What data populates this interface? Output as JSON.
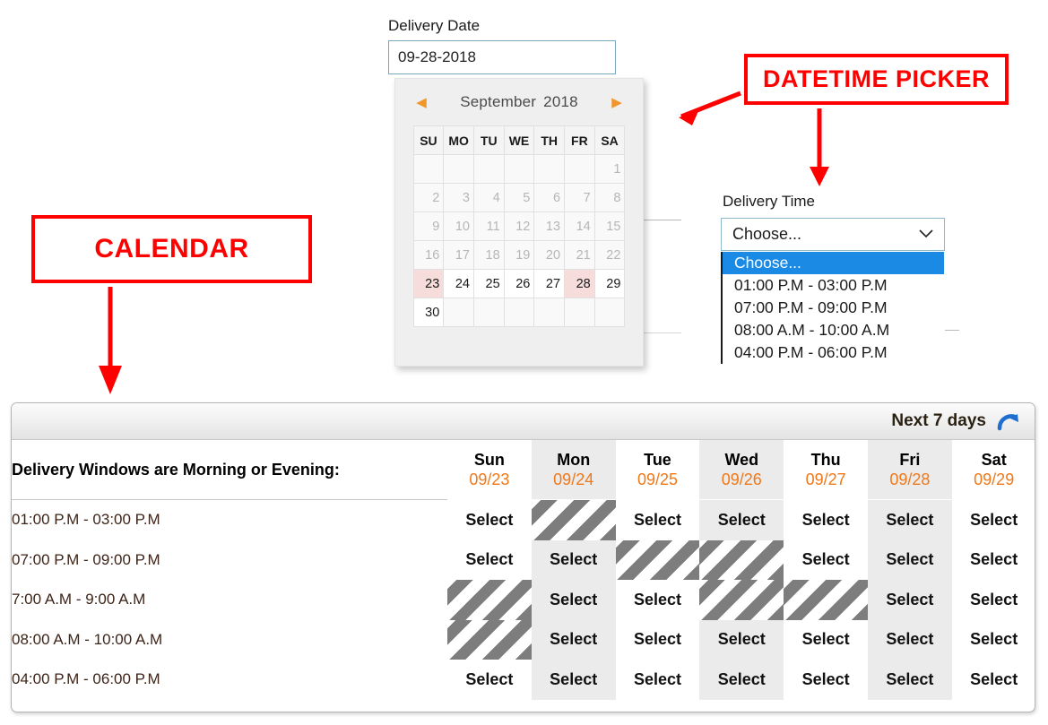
{
  "delivery_date": {
    "label": "Delivery Date",
    "value": "09-28-2018"
  },
  "calendar_popup": {
    "prev_icon": "◀",
    "next_icon": "▶",
    "month": "September",
    "year": "2018",
    "weekday_headers": [
      "SU",
      "MO",
      "TU",
      "WE",
      "TH",
      "FR",
      "SA"
    ],
    "weeks": [
      [
        {
          "d": "",
          "s": "empty"
        },
        {
          "d": "",
          "s": "empty"
        },
        {
          "d": "",
          "s": "empty"
        },
        {
          "d": "",
          "s": "empty"
        },
        {
          "d": "",
          "s": "empty"
        },
        {
          "d": "",
          "s": "empty"
        },
        {
          "d": "1",
          "s": "off"
        }
      ],
      [
        {
          "d": "2",
          "s": "off"
        },
        {
          "d": "3",
          "s": "off"
        },
        {
          "d": "4",
          "s": "off"
        },
        {
          "d": "5",
          "s": "off"
        },
        {
          "d": "6",
          "s": "off"
        },
        {
          "d": "7",
          "s": "off"
        },
        {
          "d": "8",
          "s": "off"
        }
      ],
      [
        {
          "d": "9",
          "s": "off"
        },
        {
          "d": "10",
          "s": "off"
        },
        {
          "d": "11",
          "s": "off"
        },
        {
          "d": "12",
          "s": "off"
        },
        {
          "d": "13",
          "s": "off"
        },
        {
          "d": "14",
          "s": "off"
        },
        {
          "d": "15",
          "s": "off"
        }
      ],
      [
        {
          "d": "16",
          "s": "off"
        },
        {
          "d": "17",
          "s": "off"
        },
        {
          "d": "18",
          "s": "off"
        },
        {
          "d": "19",
          "s": "off"
        },
        {
          "d": "20",
          "s": "off"
        },
        {
          "d": "21",
          "s": "off"
        },
        {
          "d": "22",
          "s": "off"
        }
      ],
      [
        {
          "d": "23",
          "s": "hi"
        },
        {
          "d": "24",
          "s": "on"
        },
        {
          "d": "25",
          "s": "on"
        },
        {
          "d": "26",
          "s": "on"
        },
        {
          "d": "27",
          "s": "on"
        },
        {
          "d": "28",
          "s": "hi"
        },
        {
          "d": "29",
          "s": "on"
        }
      ],
      [
        {
          "d": "30",
          "s": "on"
        },
        {
          "d": "",
          "s": "empty"
        },
        {
          "d": "",
          "s": "empty"
        },
        {
          "d": "",
          "s": "empty"
        },
        {
          "d": "",
          "s": "empty"
        },
        {
          "d": "",
          "s": "empty"
        },
        {
          "d": "",
          "s": "empty"
        }
      ]
    ]
  },
  "delivery_time": {
    "label": "Delivery Time",
    "selected": "Choose...",
    "caret_icon": "⌄",
    "options": [
      "Choose...",
      "01:00 P.M - 03:00 P.M",
      "07:00 P.M - 09:00 P.M",
      "08:00 A.M - 10:00 A.M",
      "04:00 P.M - 06:00 P.M"
    ],
    "selected_index": 0
  },
  "annotations": {
    "datetime_picker": "DATETIME PICKER",
    "calendar": "CALENDAR",
    "color": "#ff0000"
  },
  "delivery_panel": {
    "next_7_days": "Next 7 days",
    "redo_icon": "redo-arrow",
    "redo_color": "#1f6fd0",
    "row_header": "Delivery Windows are Morning or Evening:",
    "date_color": "#f07818",
    "days": [
      {
        "dow": "Sun",
        "date": "09/23",
        "alt": false
      },
      {
        "dow": "Mon",
        "date": "09/24",
        "alt": true
      },
      {
        "dow": "Tue",
        "date": "09/25",
        "alt": false
      },
      {
        "dow": "Wed",
        "date": "09/26",
        "alt": true
      },
      {
        "dow": "Thu",
        "date": "09/27",
        "alt": false
      },
      {
        "dow": "Fri",
        "date": "09/28",
        "alt": true
      },
      {
        "dow": "Sat",
        "date": "09/29",
        "alt": false
      }
    ],
    "select_label": "Select",
    "slots": [
      {
        "label": "01:00 P.M - 03:00 P.M",
        "cells": [
          "select",
          "hatch",
          "select",
          "select",
          "select",
          "select",
          "select"
        ]
      },
      {
        "label": "07:00 P.M - 09:00 P.M",
        "cells": [
          "select",
          "select",
          "hatch",
          "hatch",
          "select",
          "select",
          "select"
        ]
      },
      {
        "label": "7:00 A.M - 9:00 A.M",
        "cells": [
          "hatch",
          "select",
          "select",
          "hatch",
          "hatch",
          "select",
          "select"
        ]
      },
      {
        "label": "08:00 A.M - 10:00 A.M",
        "cells": [
          "hatch",
          "select",
          "select",
          "select",
          "select",
          "select",
          "select"
        ]
      },
      {
        "label": "04:00 P.M - 06:00 P.M",
        "cells": [
          "select",
          "select",
          "select",
          "select",
          "select",
          "select",
          "select"
        ]
      }
    ]
  }
}
